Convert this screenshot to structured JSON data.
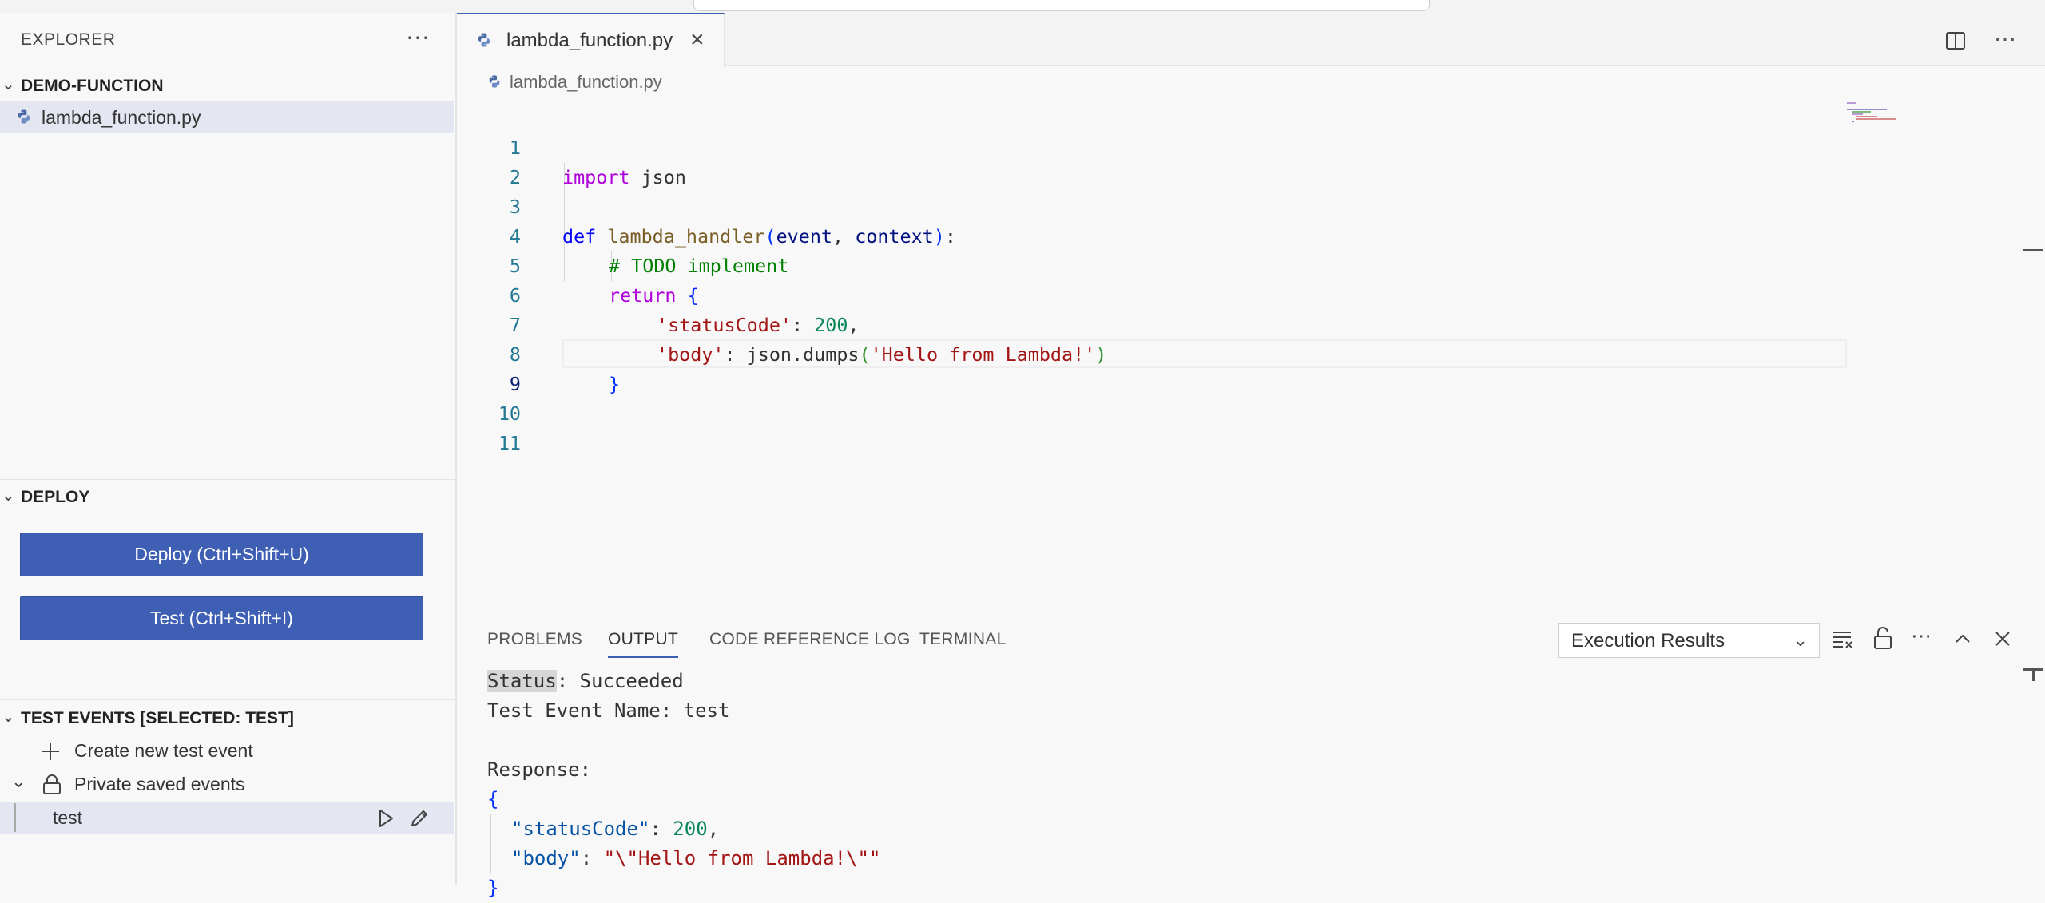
{
  "sidebar": {
    "title": "EXPLORER",
    "more_icon": "ellipsis-icon",
    "project": {
      "label": "DEMO-FUNCTION",
      "files": [
        {
          "label": "lambda_function.py"
        }
      ]
    },
    "deploy": {
      "label": "DEPLOY",
      "deploy_button": "Deploy (Ctrl+Shift+U)",
      "test_button": "Test (Ctrl+Shift+I)"
    },
    "test_events": {
      "label": "TEST EVENTS [SELECTED: TEST]",
      "create": "Create new test event",
      "private": "Private saved events",
      "selected_event": "test"
    }
  },
  "editor": {
    "tab_label": "lambda_function.py",
    "breadcrumb": "lambda_function.py",
    "line_numbers": [
      "1",
      "2",
      "3",
      "4",
      "5",
      "6",
      "7",
      "8",
      "9",
      "10",
      "11"
    ],
    "code": {
      "l1_kw": "import",
      "l1_rest": " json",
      "l3_def": "def",
      "l3_fn": "lambda_handler",
      "l3_open": "(",
      "l3_p1": "event",
      "l3_comma": ", ",
      "l3_p2": "context",
      "l3_close": ")",
      "l3_colon": ":",
      "l4_comment": "# TODO implement",
      "l5_kw": "return",
      "l5_brace": "{",
      "l6_key": "'statusCode'",
      "l6_colon": ": ",
      "l6_num": "200",
      "l6_comma": ",",
      "l7_key": "'body'",
      "l7_mid": ": json.dumps",
      "l7_open": "(",
      "l7_str": "'Hello from Lambda!'",
      "l7_close": ")",
      "l8_brace": "}"
    }
  },
  "panel": {
    "tabs": [
      "PROBLEMS",
      "OUTPUT",
      "CODE REFERENCE LOG",
      "TERMINAL"
    ],
    "active_tab": "OUTPUT",
    "output_channel": "Execution Results",
    "output": {
      "status_label": "Status",
      "status_rest": ": Succeeded",
      "event_name": "Test Event Name: test",
      "response_label": "Response:",
      "open_brace": "{",
      "status_key": "\"statusCode\"",
      "status_sep": ": ",
      "status_val": "200",
      "status_end": ",",
      "body_key": "\"body\"",
      "body_sep": ": ",
      "body_val": "\"\\\"Hello from Lambda!\\\"\"",
      "close_brace": "}"
    }
  }
}
